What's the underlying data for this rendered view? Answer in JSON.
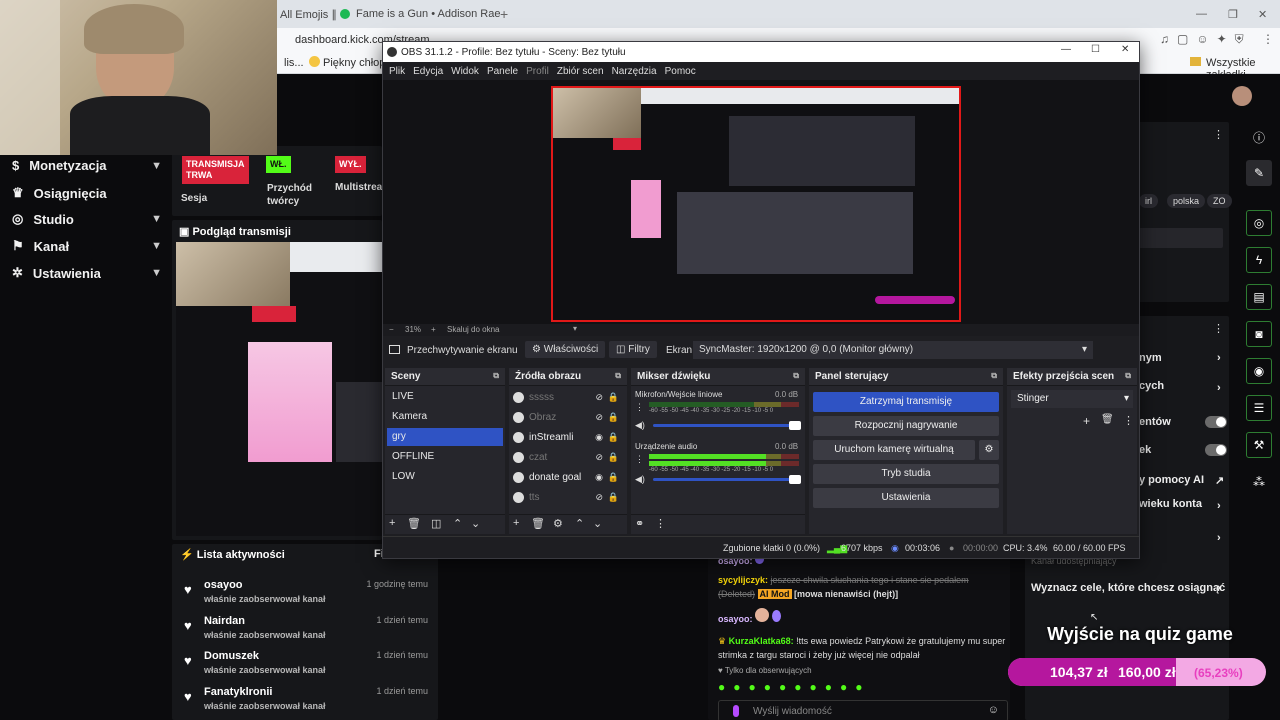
{
  "browser": {
    "tabs": [
      {
        "label": "All Emojis ∥"
      },
      {
        "label": "Fame is a Gun • Addison Rae"
      }
    ],
    "url": "dashboard.kick.com/stream",
    "bookmarks": [
      {
        "label": "lis..."
      },
      {
        "label": "Piękny chłopak (..."
      }
    ],
    "all_bookmarks": "Wszystkie zakładki"
  },
  "sidebar": {
    "items": [
      {
        "label": "Monetyzacja"
      },
      {
        "label": "Osiągnięcia"
      },
      {
        "label": "Studio"
      },
      {
        "label": "Kanał"
      },
      {
        "label": "Ustawienia"
      }
    ]
  },
  "session": {
    "badges": [
      {
        "badge": "TRANSMISJA TRWA",
        "label": "Sesja",
        "color": "#d9233a"
      },
      {
        "badge": "WŁ.",
        "label": "Przychód twórcy",
        "color": "#53fc18"
      },
      {
        "badge": "WYŁ.",
        "label": "Multistream",
        "color": "#d9233a"
      }
    ],
    "labels": {
      "b1a": "TRANSMISJA",
      "b1b": "TRWA",
      "l2a": "Przychód",
      "l2b": "twórcy",
      "l3": "Multistrea"
    }
  },
  "preview_panel": {
    "title": "Podgląd transmisji"
  },
  "activity": {
    "title": "Lista aktywności",
    "filter_label": "Fi",
    "items": [
      {
        "user": "osayoo",
        "action": "właśnie zaobserwował kanał",
        "time": "1 godzinę temu"
      },
      {
        "user": "Nairdan",
        "action": "właśnie zaobserwował kanał",
        "time": "1 dzień temu"
      },
      {
        "user": "Domuszek",
        "action": "właśnie zaobserwował kanał",
        "time": "1 dzień temu"
      },
      {
        "user": "Fanatyklronii",
        "action": "właśnie zaobserwował kanał",
        "time": "1 dzień temu"
      }
    ]
  },
  "chat": {
    "lines": [
      {
        "user": "osayoo:",
        "text": ""
      },
      {
        "user": "sycylijczyk:",
        "text": "jeszcze chwila słuchania tego i stane sie pedałem (Deleted)",
        "mod": "AI Mod",
        "reason": "[mowa nienawiści (hejt)]"
      },
      {
        "user": "osayoo:",
        "text": ""
      },
      {
        "user": "KurzaKlatka68:",
        "text": "!tts ewa powiedz Patrykowi że gratulujemy mu super strimka z targu staroci i żeby już więcej nie odpalał"
      }
    ],
    "followers_only": "Tylko dla obserwujących",
    "input_placeholder": "Wyślij wiadomość"
  },
  "right_panel": {
    "tags": [
      "irl",
      "polska",
      "ZO"
    ],
    "rows": [
      {
        "label": "nym"
      },
      {
        "label": "cych"
      },
      {
        "label": "entów"
      },
      {
        "label": "ek"
      },
      {
        "label": "y pomocy AI"
      },
      {
        "label": "wieku konta"
      }
    ],
    "shared": "Kanał udostępniający",
    "goals": "Wyznacz cele, które chcesz osiągnąć",
    "goal_title": "Wyjście na quiz game",
    "goal_current": "104,37 zł",
    "goal_target": "160,00 zł",
    "goal_percent": "(65,23%)",
    "goal_fraction": 0.6523
  },
  "obs": {
    "title": "OBS 31.1.2 - Profile: Bez tytułu - Sceny: Bez tytułu",
    "menu": [
      "Plik",
      "Edycja",
      "Widok",
      "Panele",
      "Profil",
      "Zbiór scen",
      "Narzędzia",
      "Pomoc"
    ],
    "zoom": "31%",
    "fit": "Skaluj do okna",
    "source_bar": {
      "source": "Przechwytywanie ekranu",
      "properties": "Właściwości",
      "filters": "Filtry",
      "screen_label": "Ekran",
      "screen_value": "SyncMaster: 1920x1200 @ 0,0 (Monitor główny)"
    },
    "docks": {
      "scenes": "Sceny",
      "sources": "Źródła obrazu",
      "mixer": "Mikser dźwięku",
      "controls": "Panel sterujący",
      "transitions": "Efekty przejścia scen"
    },
    "scenes": [
      {
        "name": "LIVE",
        "selected": false
      },
      {
        "name": "Kamera",
        "selected": false
      },
      {
        "name": "gry",
        "selected": true
      },
      {
        "name": "OFFLINE",
        "selected": false
      },
      {
        "name": "LOW",
        "selected": false
      }
    ],
    "sources": [
      {
        "name": "sssss",
        "visible": false
      },
      {
        "name": "Obraz",
        "visible": false
      },
      {
        "name": "inStreamli",
        "visible": true
      },
      {
        "name": "czat",
        "visible": false
      },
      {
        "name": "donate goal",
        "visible": true
      },
      {
        "name": "tts",
        "visible": false
      }
    ],
    "mixer": [
      {
        "name": "Mikrofon/Wejście liniowe",
        "db": "0.0 dB",
        "level": 0.0
      },
      {
        "name": "Urządzenie audio",
        "db": "0.0 dB",
        "level": 0.78
      }
    ],
    "meter_ticks": "-60 -55 -50 -45 -40 -35 -30 -25 -20 -15 -10 -5 0",
    "controls": [
      {
        "label": "Zatrzymaj transmisję",
        "primary": true
      },
      {
        "label": "Rozpocznij nagrywanie",
        "primary": false
      },
      {
        "label": "Uruchom kamerę wirtualną",
        "primary": false
      },
      {
        "label": "Tryb studia",
        "primary": false
      },
      {
        "label": "Ustawienia",
        "primary": false
      }
    ],
    "transition": "Stinger",
    "status": {
      "dropped": "Zgubione klatki 0 (0.0%)",
      "bitrate": "6707 kbps",
      "live_time": "00:03:06",
      "rec_time": "00:00:00",
      "cpu": "CPU: 3.4%",
      "fps": "60.00 / 60.00 FPS"
    }
  },
  "colors": {
    "kick_green": "#53fc18",
    "obs_blue": "#2f53c4",
    "rec_red": "#e11818",
    "goal_pink": "#b5179e"
  }
}
